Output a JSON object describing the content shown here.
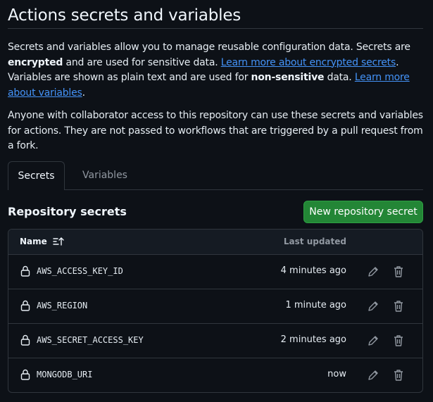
{
  "page": {
    "title": "Actions secrets and variables",
    "desc1": {
      "t1": "Secrets and variables allow you to manage reusable configuration data. Secrets are ",
      "b1": "encrypted",
      "t2": " and are used for sensitive data. ",
      "link1": "Learn more about encrypted secrets",
      "t3": ". Variables are shown as plain text and are used for ",
      "b2": "non-sensitive",
      "t4": " data. ",
      "link2": "Learn more about variables",
      "t5": "."
    },
    "desc2": "Anyone with collaborator access to this repository can use these secrets and variables for actions. They are not passed to workflows that are triggered by a pull request from a fork."
  },
  "tabs": [
    {
      "label": "Secrets",
      "active": true
    },
    {
      "label": "Variables",
      "active": false
    }
  ],
  "section": {
    "title": "Repository secrets",
    "new_button": "New repository secret"
  },
  "table": {
    "headers": {
      "name": "Name",
      "updated": "Last updated"
    },
    "sort_icon": "sort-ascending-icon",
    "rows": [
      {
        "name": "AWS_ACCESS_KEY_ID",
        "updated": "4 minutes ago"
      },
      {
        "name": "AWS_REGION",
        "updated": "1 minute ago"
      },
      {
        "name": "AWS_SECRET_ACCESS_KEY",
        "updated": "2 minutes ago"
      },
      {
        "name": "MONGODB_URI",
        "updated": "now"
      }
    ]
  },
  "colors": {
    "background": "#0d1117",
    "primary_button": "#238636",
    "link": "#4493f8",
    "border": "#30363d"
  }
}
